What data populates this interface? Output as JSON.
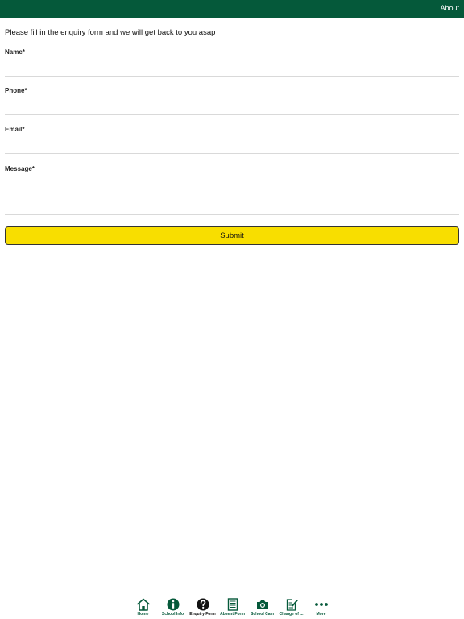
{
  "topbar": {
    "about_label": "About",
    "bg_color": "#05593a"
  },
  "intro_text": "Please fill in the enquiry form and we will get back to you asap",
  "form": {
    "fields": [
      {
        "label": "Name*",
        "value": ""
      },
      {
        "label": "Phone*",
        "value": ""
      },
      {
        "label": "Email*",
        "value": ""
      },
      {
        "label": "Message*",
        "value": ""
      }
    ],
    "submit_label": "Submit",
    "submit_color": "#f8de00"
  },
  "tabbar": {
    "active_index": 2,
    "tabs": [
      {
        "label": "Home",
        "icon": "home-icon"
      },
      {
        "label": "School Info",
        "icon": "info-icon"
      },
      {
        "label": "Enquiry Form",
        "icon": "question-icon"
      },
      {
        "label": "Absent Form",
        "icon": "form-icon"
      },
      {
        "label": "School Cam",
        "icon": "camera-icon"
      },
      {
        "label": "Change of ...",
        "icon": "edit-document-icon"
      },
      {
        "label": "More",
        "icon": "more-icon"
      }
    ]
  }
}
